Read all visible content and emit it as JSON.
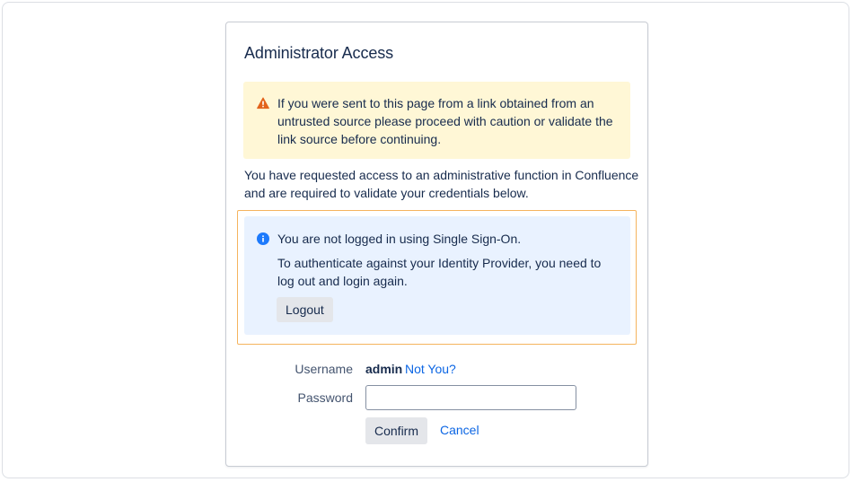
{
  "dialog": {
    "title": "Administrator Access"
  },
  "warning": {
    "icon": "warning-icon",
    "color": "#e2621b",
    "text": "If you were sent to this page from a link obtained from an untrusted source please proceed with caution or validate the link source before continuing."
  },
  "intro": {
    "text": "You have requested access to an administrative function in Confluence and are required to validate your credentials below."
  },
  "sso_notice": {
    "icon": "info-icon",
    "color": "#1d7afc",
    "title": "You are not logged in using Single Sign-On.",
    "body": "To authenticate against your Identity Provider, you need to log out and login again.",
    "logout_label": "Logout"
  },
  "form": {
    "username_label": "Username",
    "username_value": "admin",
    "not_you_label": "Not You?",
    "password_label": "Password",
    "password_value": "",
    "confirm_label": "Confirm",
    "cancel_label": "Cancel"
  },
  "colors": {
    "link": "#0c66e4",
    "warning_bg": "#fff7d6",
    "info_bg": "#e9f2ff",
    "focus_ring": "#f5b45e"
  }
}
